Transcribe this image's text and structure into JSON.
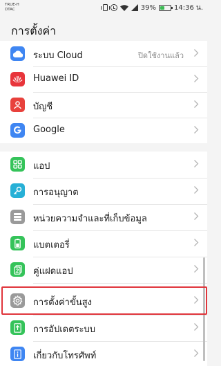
{
  "status_bar": {
    "carrier_1": "TRUE-H",
    "carrier_2": "DTAC",
    "battery_percent_label": "39%",
    "battery_level": 0.39,
    "time": "14:36 น."
  },
  "page": {
    "title": "การตั้งค่า"
  },
  "group_1": [
    {
      "name": "cloud",
      "label": "ระบบ Cloud",
      "value": "ปิดใช้งานแล้ว",
      "icon": "cloud-icon",
      "color": "#3f86f2"
    },
    {
      "name": "huawei-id",
      "label": "Huawei ID",
      "value": "",
      "icon": "huawei-logo-icon",
      "color": "#e8353b"
    },
    {
      "name": "accounts",
      "label": "บัญชี",
      "value": "",
      "icon": "account-icon",
      "color": "#e8413c"
    },
    {
      "name": "google",
      "label": "Google",
      "value": "",
      "icon": "google-icon",
      "color": "#3f86f2"
    }
  ],
  "group_2": [
    {
      "name": "apps",
      "label": "แอป",
      "icon": "apps-icon",
      "color": "#35c35a"
    },
    {
      "name": "permissions",
      "label": "การอนุญาต",
      "icon": "key-icon",
      "color": "#27b0d6"
    },
    {
      "name": "storage",
      "label": "หน่วยความจำและที่เก็บข้อมูล",
      "icon": "storage-icon",
      "color": "#9a9a9a"
    },
    {
      "name": "battery",
      "label": "แบตเตอรี่",
      "icon": "battery-icon",
      "color": "#35c35a"
    },
    {
      "name": "app-twin",
      "label": "คู่แฝดแอป",
      "icon": "app-twin-icon",
      "color": "#35c35a"
    },
    {
      "name": "advanced-settings",
      "label": "การตั้งค่าขั้นสูง",
      "icon": "gear-icon",
      "color": "#9a9a9a"
    },
    {
      "name": "system-update",
      "label": "การอัปเดตระบบ",
      "icon": "update-icon",
      "color": "#35c35a"
    },
    {
      "name": "about-phone",
      "label": "เกี่ยวกับโทรศัพท์",
      "icon": "info-icon",
      "color": "#3f86f2"
    }
  ],
  "highlighted_item": "advanced-settings",
  "colors": {
    "highlight": "#e0353b",
    "background": "#f4f4f4",
    "card": "#ffffff"
  }
}
